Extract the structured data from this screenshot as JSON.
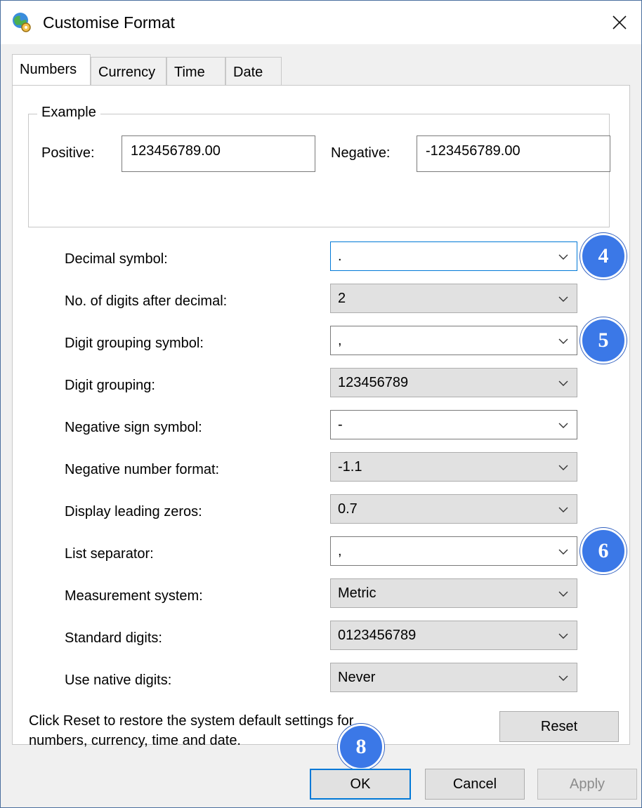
{
  "window": {
    "title": "Customise Format",
    "icon": "globe-settings-icon",
    "close_icon": "close-icon"
  },
  "tabs": [
    {
      "label": "Numbers",
      "active": true
    },
    {
      "label": "Currency",
      "active": false
    },
    {
      "label": "Time",
      "active": false
    },
    {
      "label": "Date",
      "active": false
    }
  ],
  "example": {
    "legend": "Example",
    "positive_label": "Positive:",
    "positive_value": "123456789.00",
    "negative_label": "Negative:",
    "negative_value": "-123456789.00"
  },
  "settings": [
    {
      "label": "Decimal symbol:",
      "value": ".",
      "editable": true
    },
    {
      "label": "No. of digits after decimal:",
      "value": "2",
      "editable": false
    },
    {
      "label": "Digit grouping symbol:",
      "value": ",",
      "editable": true
    },
    {
      "label": "Digit grouping:",
      "value": "123456789",
      "editable": false
    },
    {
      "label": "Negative sign symbol:",
      "value": "-",
      "editable": true
    },
    {
      "label": "Negative number format:",
      "value": "-1.1",
      "editable": false
    },
    {
      "label": "Display leading zeros:",
      "value": "0.7",
      "editable": false
    },
    {
      "label": "List separator:",
      "value": ",",
      "editable": true
    },
    {
      "label": "Measurement system:",
      "value": "Metric",
      "editable": false
    },
    {
      "label": "Standard digits:",
      "value": "0123456789",
      "editable": false
    },
    {
      "label": "Use native digits:",
      "value": "Never",
      "editable": false
    }
  ],
  "footer": {
    "reset_note_line1": "Click Reset to restore the system default settings for",
    "reset_note_line2": "numbers, currency, time and date.",
    "reset_button": "Reset"
  },
  "buttons": {
    "ok": "OK",
    "cancel": "Cancel",
    "apply": "Apply"
  },
  "callouts": {
    "decimal": "4",
    "grouping": "5",
    "list": "6",
    "ok": "8"
  },
  "colors": {
    "callout": "#3b78e7",
    "focus": "#0078d7",
    "disabled_text": "#8c8c8c"
  }
}
